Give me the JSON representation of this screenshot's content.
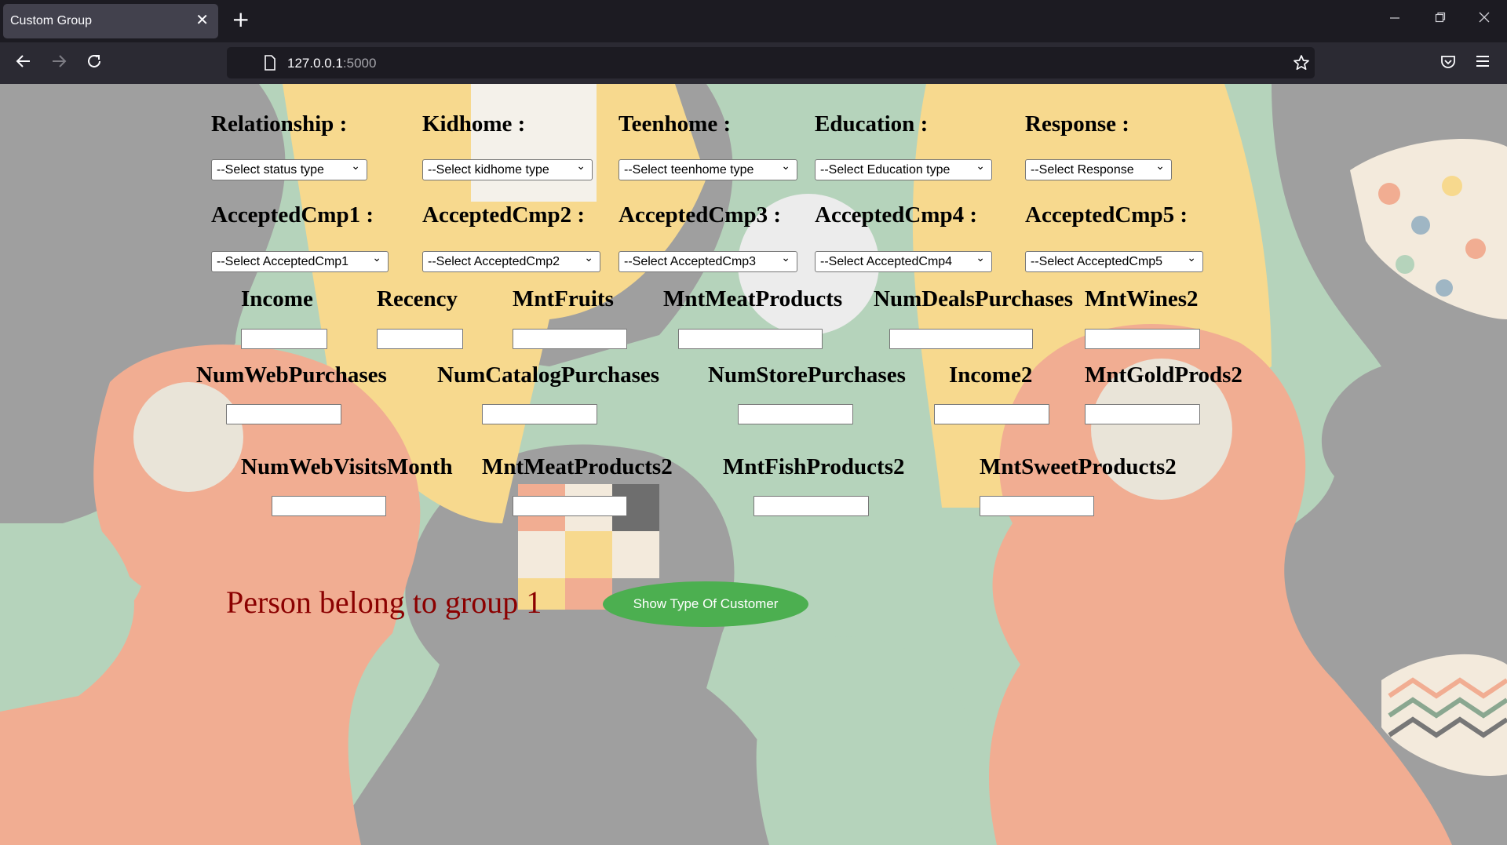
{
  "browser": {
    "tab_title": "Custom Group",
    "tab_close_icon": "✕",
    "new_tab_icon": "+",
    "url_host": "127.0.0.1",
    "url_port": ":5000",
    "icons": {
      "back": "back-arrow-icon",
      "forward": "forward-arrow-icon",
      "reload": "reload-icon",
      "shield": "shield-icon",
      "page": "page-icon",
      "bookmark": "star-icon",
      "pocket": "pocket-icon",
      "menu": "hamburger-menu-icon",
      "minimize": "minimize-icon",
      "restore": "restore-icon",
      "close": "close-icon"
    }
  },
  "form": {
    "selects": [
      {
        "label": "Relationship :",
        "value": "--Select status type"
      },
      {
        "label": "Kidhome :",
        "value": "--Select kidhome type"
      },
      {
        "label": "Teenhome :",
        "value": "--Select teenhome type"
      },
      {
        "label": "Education :",
        "value": "--Select Education type"
      },
      {
        "label": "Response :",
        "value": "--Select Response"
      },
      {
        "label": "AcceptedCmp1 :",
        "value": "--Select AcceptedCmp1"
      },
      {
        "label": "AcceptedCmp2 :",
        "value": "--Select AcceptedCmp2"
      },
      {
        "label": "AcceptedCmp3 :",
        "value": "--Select AcceptedCmp3"
      },
      {
        "label": "AcceptedCmp4 :",
        "value": "--Select AcceptedCmp4"
      },
      {
        "label": "AcceptedCmp5 :",
        "value": "--Select AcceptedCmp5"
      }
    ],
    "inputs": [
      {
        "label": "Income",
        "value": ""
      },
      {
        "label": "Recency",
        "value": ""
      },
      {
        "label": "MntFruits",
        "value": ""
      },
      {
        "label": "MntMeatProducts",
        "value": ""
      },
      {
        "label": "NumDealsPurchases",
        "value": ""
      },
      {
        "label": "MntWines2",
        "value": ""
      },
      {
        "label": "NumWebPurchases",
        "value": ""
      },
      {
        "label": "NumCatalogPurchases",
        "value": ""
      },
      {
        "label": "NumStorePurchases",
        "value": ""
      },
      {
        "label": "Income2",
        "value": ""
      },
      {
        "label": "MntGoldProds2",
        "value": ""
      },
      {
        "label": "NumWebVisitsMonth",
        "value": ""
      },
      {
        "label": "MntMeatProducts2",
        "value": ""
      },
      {
        "label": "MntFishProducts2",
        "value": ""
      },
      {
        "label": "MntSweetProducts2",
        "value": ""
      }
    ],
    "result_text": "Person belong to group 1",
    "submit_label": "Show Type Of Customer",
    "button_color": "#4caf50",
    "result_color": "#8b0000"
  }
}
